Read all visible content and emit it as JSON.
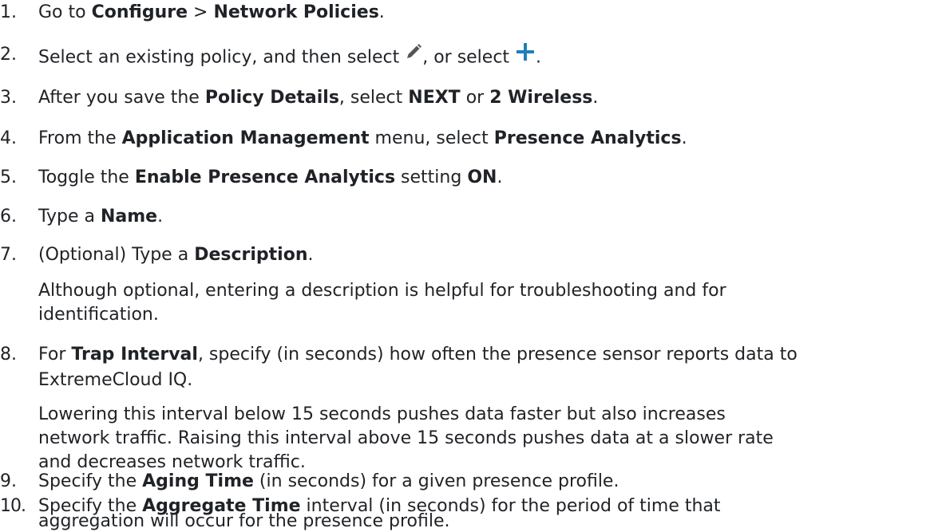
{
  "steps": [
    {
      "num": "1.",
      "parts": [
        {
          "t": "Go to "
        },
        {
          "t": "Configure",
          "b": true
        },
        {
          "t": " > "
        },
        {
          "t": "Network Policies",
          "b": true
        },
        {
          "t": "."
        }
      ]
    },
    {
      "num": "2.",
      "parts": [
        {
          "t": "Select an existing policy, and then select "
        },
        {
          "icon": "pencil-icon"
        },
        {
          "t": ", or select "
        },
        {
          "icon": "plus-icon"
        },
        {
          "t": "."
        }
      ]
    },
    {
      "num": "3.",
      "parts": [
        {
          "t": "After you save the "
        },
        {
          "t": "Policy Details",
          "b": true
        },
        {
          "t": ", select "
        },
        {
          "t": "NEXT",
          "b": true
        },
        {
          "t": " or "
        },
        {
          "t": "2 Wireless",
          "b": true
        },
        {
          "t": "."
        }
      ]
    },
    {
      "num": "4.",
      "parts": [
        {
          "t": "From the "
        },
        {
          "t": "Application Management",
          "b": true
        },
        {
          "t": " menu, select "
        },
        {
          "t": "Presence Analytics",
          "b": true
        },
        {
          "t": "."
        }
      ]
    },
    {
      "num": "5.",
      "parts": [
        {
          "t": "Toggle the "
        },
        {
          "t": "Enable Presence Analytics",
          "b": true
        },
        {
          "t": " setting "
        },
        {
          "t": "ON",
          "b": true
        },
        {
          "t": "."
        }
      ]
    },
    {
      "num": "6.",
      "parts": [
        {
          "t": "Type a "
        },
        {
          "t": "Name",
          "b": true
        },
        {
          "t": "."
        }
      ]
    },
    {
      "num": "7.",
      "parts": [
        {
          "t": "(Optional) Type a "
        },
        {
          "t": "Description",
          "b": true
        },
        {
          "t": "."
        }
      ]
    },
    {
      "num": "8.",
      "parts": [
        {
          "t": "For "
        },
        {
          "t": "Trap Interval",
          "b": true
        },
        {
          "t": ", specify (in seconds) how often the presence sensor reports data to"
        }
      ]
    },
    {
      "num": "9.",
      "parts": [
        {
          "t": "Specify the "
        },
        {
          "t": "Aging Time",
          "b": true
        },
        {
          "t": " (in seconds) for a given presence profile."
        }
      ]
    },
    {
      "num": "10.",
      "parts": [
        {
          "t": "Specify the "
        },
        {
          "t": "Aggregate Time",
          "b": true
        },
        {
          "t": " interval (in seconds) for the period of time that"
        }
      ]
    }
  ],
  "continuations": {
    "step7_note_line1": "Although optional, entering a description is helpful for troubleshooting and for",
    "step7_note_line2": "identification.",
    "step8_line2": "ExtremeCloud IQ.",
    "step8_note_line1": "Lowering this interval below 15 seconds pushes data faster but also increases",
    "step8_note_line2": "network traffic. Raising this interval above 15 seconds pushes data at a slower rate",
    "step8_note_line3": "and decreases network traffic.",
    "step10_line2": "aggregation will occur for the presence profile."
  },
  "colors": {
    "text": "#1f2226",
    "pencil_icon": "#555555",
    "plus_icon": "#1f7fb8"
  }
}
